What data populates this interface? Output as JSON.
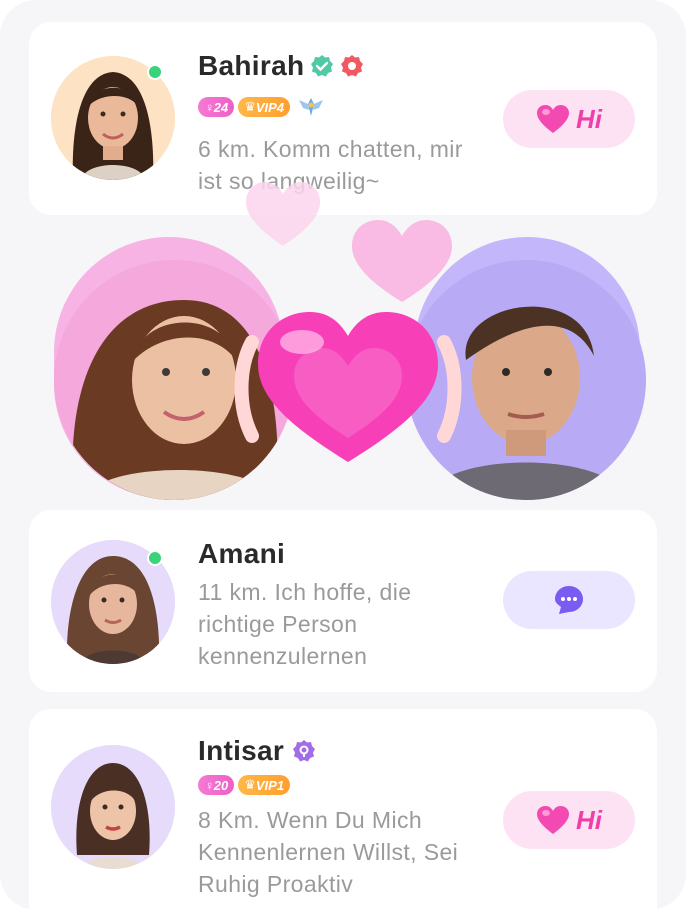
{
  "users": [
    {
      "name": "Bahirah",
      "age_badge": "24",
      "vip_badge": "VIP4",
      "description": "6 km. Komm chatten, mir ist so langweilig~",
      "action_label": "Hi",
      "online": true
    },
    {
      "name": "Amani",
      "description": "11 km. Ich hoffe, die richtige Person kennenzulernen",
      "online": true
    },
    {
      "name": "Intisar",
      "age_badge": "20",
      "vip_badge": "VIP1",
      "description": "8 Km. Wenn Du Mich Kennenlernen Willst, Sei Ruhig Proaktiv",
      "action_label": "Hi",
      "online": false
    }
  ],
  "icons": {
    "verified": "verified-check-icon",
    "certified": "pink-badge-icon",
    "rank": "winged-rank-icon",
    "chat": "chat-bubble-icon",
    "heart": "heart-icon"
  },
  "colors": {
    "online": "#3ad37a",
    "hi_pink": "#ef3fa9",
    "hi_bg": "#fde2f4",
    "chat_bg": "#ebe6ff",
    "accent_purple": "#7b5cf0"
  }
}
